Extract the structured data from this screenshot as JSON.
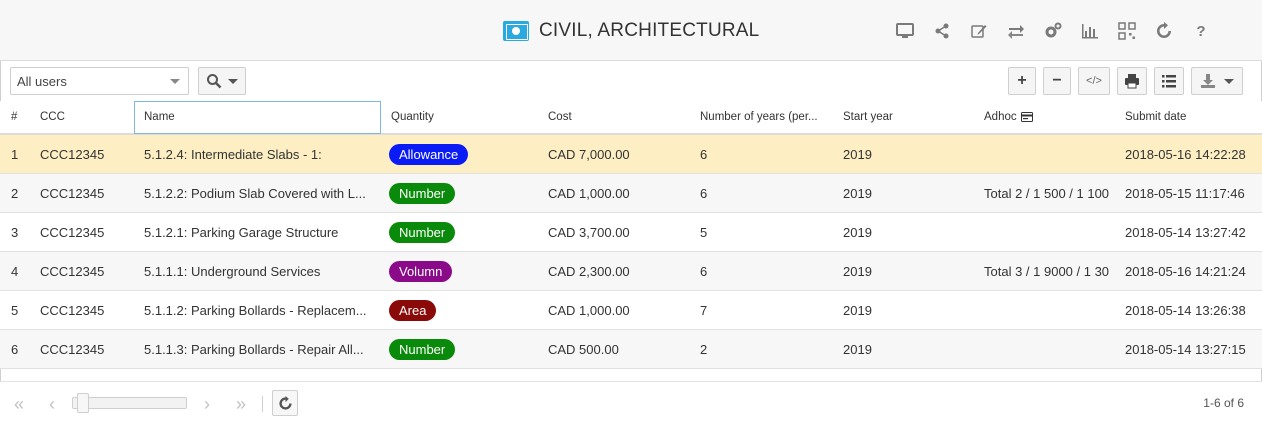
{
  "header": {
    "title": "CIVIL, ARCHITECTURAL",
    "icons": [
      "monitor-icon",
      "share-icon",
      "edit-icon",
      "swap-icon",
      "settings-icon",
      "chart-icon",
      "qrcode-icon",
      "refresh-icon",
      "help-icon"
    ]
  },
  "toolbar": {
    "user_filter": "All users",
    "add_label": "+",
    "remove_label": "−",
    "code_label": "</>"
  },
  "table": {
    "columns": {
      "index": "#",
      "ccc": "CCC",
      "name": "Name",
      "quantity": "Quantity",
      "cost": "Cost",
      "years": "Number of years (per...",
      "start_year": "Start year",
      "adhoc": "Adhoc",
      "submit_date": "Submit date"
    },
    "rows": [
      {
        "index": "1",
        "ccc": "CCC12345",
        "name": "5.1.2.4: Intermediate Slabs - 1:",
        "quantity": "Allowance",
        "quantity_color": "#0b1bf5",
        "cost": "CAD 7,000.00",
        "years": "6",
        "start_year": "2019",
        "adhoc": "",
        "submit_date": "2018-05-16 14:22:28"
      },
      {
        "index": "2",
        "ccc": "CCC12345",
        "name": "5.1.2.2: Podium Slab Covered with L...",
        "quantity": "Number",
        "quantity_color": "#0a8a0a",
        "cost": "CAD 1,000.00",
        "years": "6",
        "start_year": "2019",
        "adhoc": "Total 2 / 1 500 / 1 100",
        "submit_date": "2018-05-15 11:17:46"
      },
      {
        "index": "3",
        "ccc": "CCC12345",
        "name": "5.1.2.1: Parking Garage Structure",
        "quantity": "Number",
        "quantity_color": "#0a8a0a",
        "cost": "CAD 3,700.00",
        "years": "5",
        "start_year": "2019",
        "adhoc": "",
        "submit_date": "2018-05-14 13:27:42"
      },
      {
        "index": "4",
        "ccc": "CCC12345",
        "name": "5.1.1.1: Underground Services",
        "quantity": "Volumn",
        "quantity_color": "#8a0a8a",
        "cost": "CAD 2,300.00",
        "years": "6",
        "start_year": "2019",
        "adhoc": "Total 3 / 1 9000 / 1 30",
        "submit_date": "2018-05-16 14:21:24"
      },
      {
        "index": "5",
        "ccc": "CCC12345",
        "name": "5.1.1.2: Parking Bollards - Replacem...",
        "quantity": "Area",
        "quantity_color": "#8a0a0a",
        "cost": "CAD 1,000.00",
        "years": "7",
        "start_year": "2019",
        "adhoc": "",
        "submit_date": "2018-05-14 13:26:38"
      },
      {
        "index": "6",
        "ccc": "CCC12345",
        "name": "5.1.1.3: Parking Bollards - Repair All...",
        "quantity": "Number",
        "quantity_color": "#0a8a0a",
        "cost": "CAD 500.00",
        "years": "2",
        "start_year": "2019",
        "adhoc": "",
        "submit_date": "2018-05-14 13:27:15"
      }
    ]
  },
  "footer": {
    "page_info": "1-6 of 6"
  }
}
